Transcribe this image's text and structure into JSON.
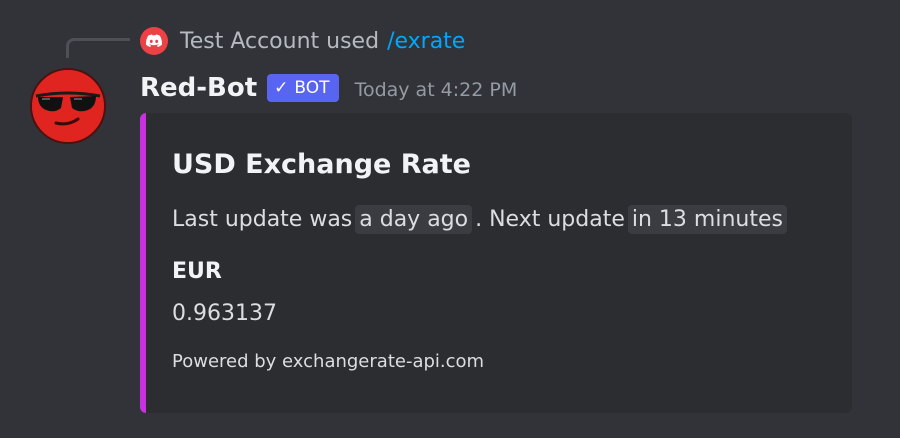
{
  "reply": {
    "author": "Test Account",
    "action": "used",
    "command": "/exrate",
    "avatar_icon": "discord-logo-icon"
  },
  "message": {
    "author": "Red-Bot",
    "bot_tag": "BOT",
    "bot_tag_icon": "checkmark-icon",
    "timestamp": "Today at 4:22 PM",
    "avatar_icon": "sunglasses-face-icon"
  },
  "embed": {
    "accent_color": "#c930e0",
    "title": "USD Exchange Rate",
    "desc_prefix": "Last update was",
    "last_update": "a day ago",
    "desc_middle": ". Next update",
    "next_update": "in 13 minutes",
    "field_name": "EUR",
    "field_value": "0.963137",
    "footer": "Powered by exchangerate-api.com"
  },
  "colors": {
    "background": "#313338",
    "embed_background": "#2b2d31",
    "link": "#00a8fc",
    "bot_tag": "#5865f2",
    "avatar": "#e0241f"
  }
}
